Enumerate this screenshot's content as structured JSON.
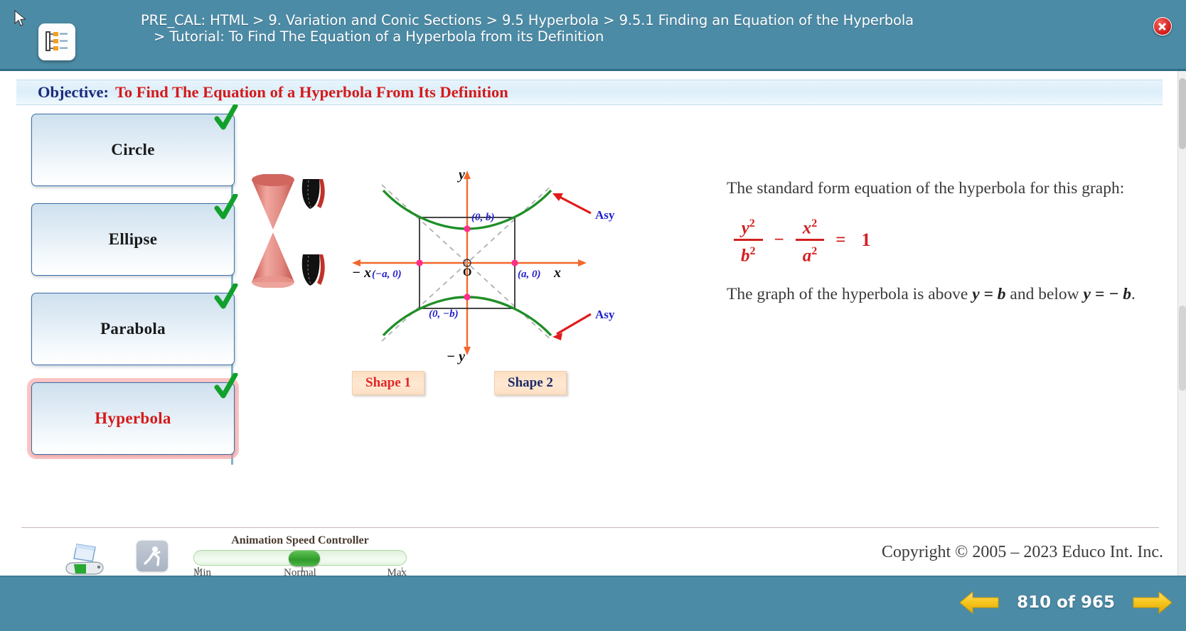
{
  "header": {
    "breadcrumb_line1": "PRE_CAL: HTML > 9. Variation and Conic Sections > 9.5 Hyperbola > 9.5.1 Finding an Equation of the Hyperbola",
    "breadcrumb_line2": "> Tutorial: To Find The Equation of a Hyperbola from its Definition",
    "nav_icon": "tree-outline-icon",
    "close_icon": "close-icon",
    "cursor_icon": "mouse-pointer-icon",
    "bg_color": "#4c8ba6"
  },
  "objective": {
    "label": "Objective:",
    "text": "To Find The Equation of a Hyperbola From Its Definition",
    "label_color": "#1c2a7a",
    "text_color": "#d51a1a"
  },
  "sidebar": {
    "items": [
      {
        "label": "Circle",
        "checked": true,
        "selected": false
      },
      {
        "label": "Ellipse",
        "checked": true,
        "selected": false
      },
      {
        "label": "Parabola",
        "checked": true,
        "selected": false
      },
      {
        "label": "Hyperbola",
        "checked": true,
        "selected": true
      }
    ],
    "check_color": "#12a02c",
    "selected_text_color": "#d51a1a"
  },
  "diagram": {
    "axis_labels": {
      "y_pos": "y",
      "y_neg": "− y",
      "x_pos": "x",
      "x_neg": "− x",
      "origin": "O"
    },
    "point_labels": {
      "top": "(0, b)",
      "bottom": "(0, −b)",
      "left": "(−a, 0)",
      "right": "(a, 0)"
    },
    "annotations": [
      {
        "text": "Asymptotes",
        "position": "upper-right"
      },
      {
        "text": "Asymptotes",
        "position": "lower-right"
      }
    ],
    "annotation_color": "#2222cc",
    "curve_color": "#1f8f28",
    "axis_color": "#f4682a",
    "point_color": "#ff2e8b",
    "asymptote_color": "#aaaaaa",
    "cone_color": "#d9756e",
    "shape_buttons": [
      {
        "label": "Shape 1",
        "active": true,
        "color": "#e22626"
      },
      {
        "label": "Shape 2",
        "active": false,
        "color": "#1e2a66"
      }
    ]
  },
  "explanation": {
    "intro": "The standard form equation of the hyperbola for this graph:",
    "equation": {
      "num1": "y",
      "num1_sup": "2",
      "den1": "b",
      "den1_sup": "2",
      "operator": "−",
      "num2": "x",
      "num2_sup": "2",
      "den2": "a",
      "den2_sup": "2",
      "equals": "=",
      "rhs": "1",
      "color": "#d22020"
    },
    "note_part1": "The graph of the hyperbola is above",
    "note_var1": "y  =  b",
    "note_part2": "and below",
    "note_var2": "y  =  − b",
    "note_end": "."
  },
  "toolbar": {
    "print_icon": "printer-icon",
    "animation_icon": "animation-person-icon",
    "speed_title": "Animation Speed Controller",
    "speed_min": "Min",
    "speed_normal": "Normal",
    "speed_max": "Max",
    "speed_value": "Normal",
    "copyright": "Copyright © 2005 – 2023 Educo Int. Inc."
  },
  "footer": {
    "prev_icon": "arrow-left-icon",
    "next_icon": "arrow-right-icon",
    "page_text": "810  of  965",
    "current_page": "810",
    "total_pages": "965",
    "bg_color": "#4c8ba6",
    "arrow_color": "#f5c518"
  }
}
